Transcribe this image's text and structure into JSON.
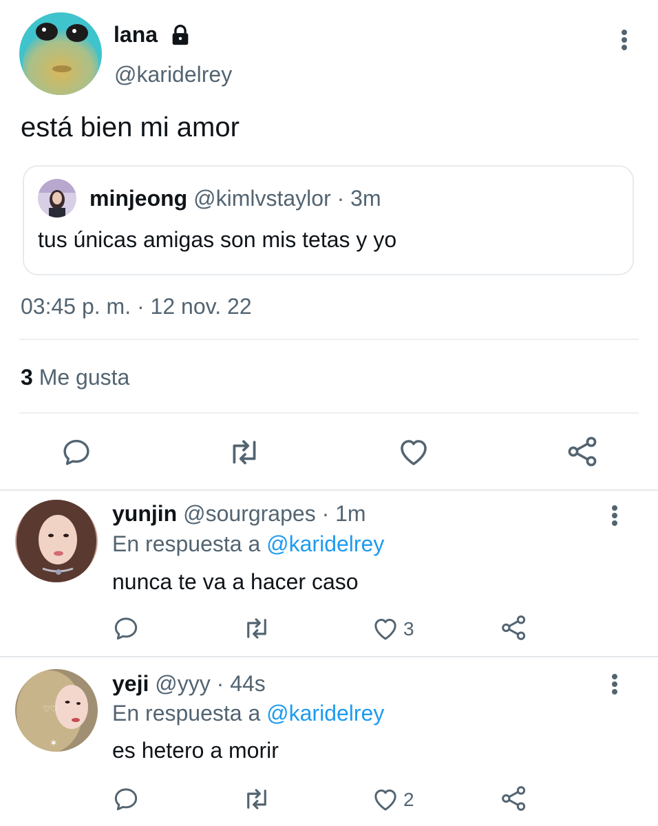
{
  "main_tweet": {
    "display_name": "lana",
    "handle": "@karidelrey",
    "text": "está bien mi amor",
    "quoted": {
      "display_name": "minjeong",
      "handle": "@kimlvstaylor",
      "time": "· 3m",
      "text": "tus únicas amigas son mis tetas y yo"
    },
    "timestamp": "03:45 p. m. · 12 nov. 22",
    "likes_count": "3",
    "likes_label": "Me gusta"
  },
  "replies": [
    {
      "display_name": "yunjin",
      "handle": "@sourgrapes",
      "time": "· 1m",
      "replying_prefix": "En respuesta a",
      "replying_to": "@karidelrey",
      "text": "nunca te va a hacer caso",
      "like_count": "3"
    },
    {
      "display_name": "yeji",
      "handle": "@yyy",
      "time": "· 44s",
      "replying_prefix": "En respuesta a",
      "replying_to": "@karidelrey",
      "text": "es hetero a morir",
      "like_count": "2"
    }
  ],
  "icons": {
    "lock": "lock-icon",
    "more": "more-vertical-icon",
    "reply": "reply-icon",
    "retweet": "retweet-icon",
    "like": "heart-icon",
    "share": "share-icon"
  },
  "colors": {
    "text": "#0f1419",
    "secondary": "#536471",
    "link": "#1d9bf0",
    "divider": "#eceef0"
  }
}
